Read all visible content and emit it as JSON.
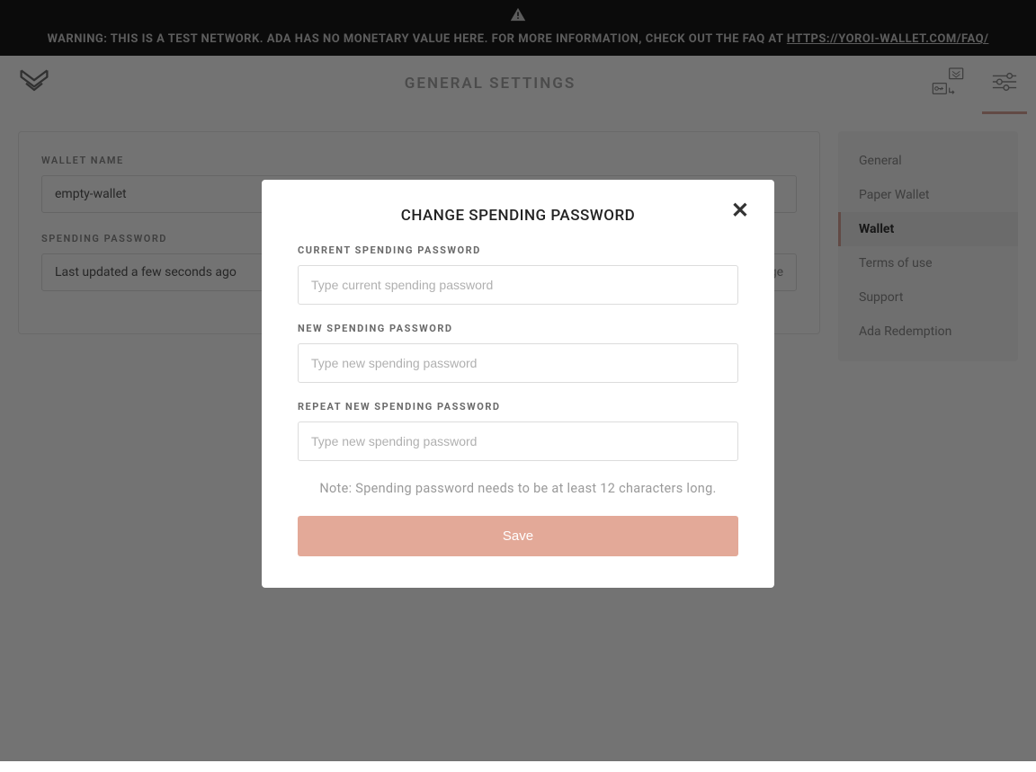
{
  "banner": {
    "text": "WARNING: THIS IS A TEST NETWORK. ADA HAS NO MONETARY VALUE HERE. FOR MORE INFORMATION, CHECK OUT THE FAQ AT ",
    "link_text": "HTTPS://YOROI-WALLET.COM/FAQ/"
  },
  "header": {
    "title": "GENERAL SETTINGS"
  },
  "content": {
    "wallet_name_label": "WALLET NAME",
    "wallet_name_value": "empty-wallet",
    "spending_password_label": "SPENDING PASSWORD",
    "spending_password_value": "Last updated a few seconds ago",
    "change_link": "change"
  },
  "sidebar": {
    "items": [
      {
        "label": "General",
        "active": false
      },
      {
        "label": "Paper Wallet",
        "active": false
      },
      {
        "label": "Wallet",
        "active": true
      },
      {
        "label": "Terms of use",
        "active": false
      },
      {
        "label": "Support",
        "active": false
      },
      {
        "label": "Ada Redemption",
        "active": false
      }
    ]
  },
  "modal": {
    "title": "CHANGE SPENDING PASSWORD",
    "current_label": "CURRENT SPENDING PASSWORD",
    "current_placeholder": "Type current spending password",
    "new_label": "NEW SPENDING PASSWORD",
    "new_placeholder": "Type new spending password",
    "repeat_label": "REPEAT NEW SPENDING PASSWORD",
    "repeat_placeholder": "Type new spending password",
    "note": "Note: Spending password needs to be at least 12 characters long.",
    "save_label": "Save"
  },
  "colors": {
    "accent": "#daa49a",
    "banner_bg": "#1a1a1a"
  }
}
